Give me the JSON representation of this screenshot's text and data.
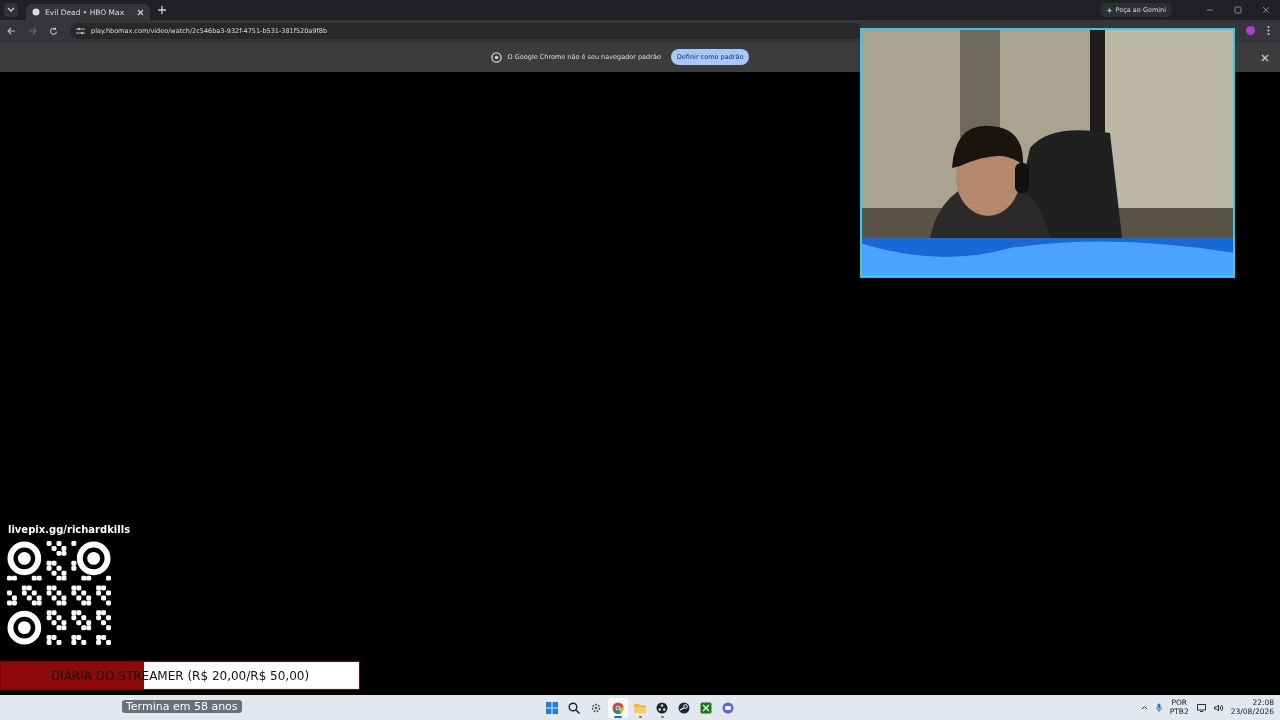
{
  "browser": {
    "tab": {
      "title": "Evil Dead • HBO Max",
      "selected": true
    },
    "url": "play.hbomax.com/video/watch/2c546ba3-932f-4751-b531-381f520a9f8b",
    "gemini_button": "Peça ao Gemini",
    "infobar": {
      "message": "O Google Chrome não é seu navegador padrão",
      "button": "Definir como padrão"
    }
  },
  "overlay": {
    "donation_link": "livepix.gg/richardkills",
    "goal": {
      "label": "DIÁRIA DO STREAMER (R$ 20,00/R$ 50,00)",
      "level": 0.4,
      "subtitle": "Termina em 58 anos"
    }
  },
  "taskbar": {
    "apps": [
      {
        "kind": "start",
        "selected": false,
        "open": false
      },
      {
        "kind": "search",
        "selected": false,
        "open": false
      },
      {
        "kind": "gear",
        "selected": false,
        "open": false
      },
      {
        "kind": "browser",
        "selected": true,
        "open": true
      },
      {
        "kind": "folder",
        "selected": false,
        "open": true
      },
      {
        "kind": "recorder",
        "selected": false,
        "open": true
      },
      {
        "kind": "steam",
        "selected": false,
        "open": false
      },
      {
        "kind": "xbox",
        "selected": false,
        "open": false
      },
      {
        "kind": "chat",
        "selected": false,
        "open": false
      }
    ],
    "tray": {
      "language": "POR",
      "layout": "PTB2",
      "time": "22:08",
      "date": "23/08/2026"
    }
  }
}
